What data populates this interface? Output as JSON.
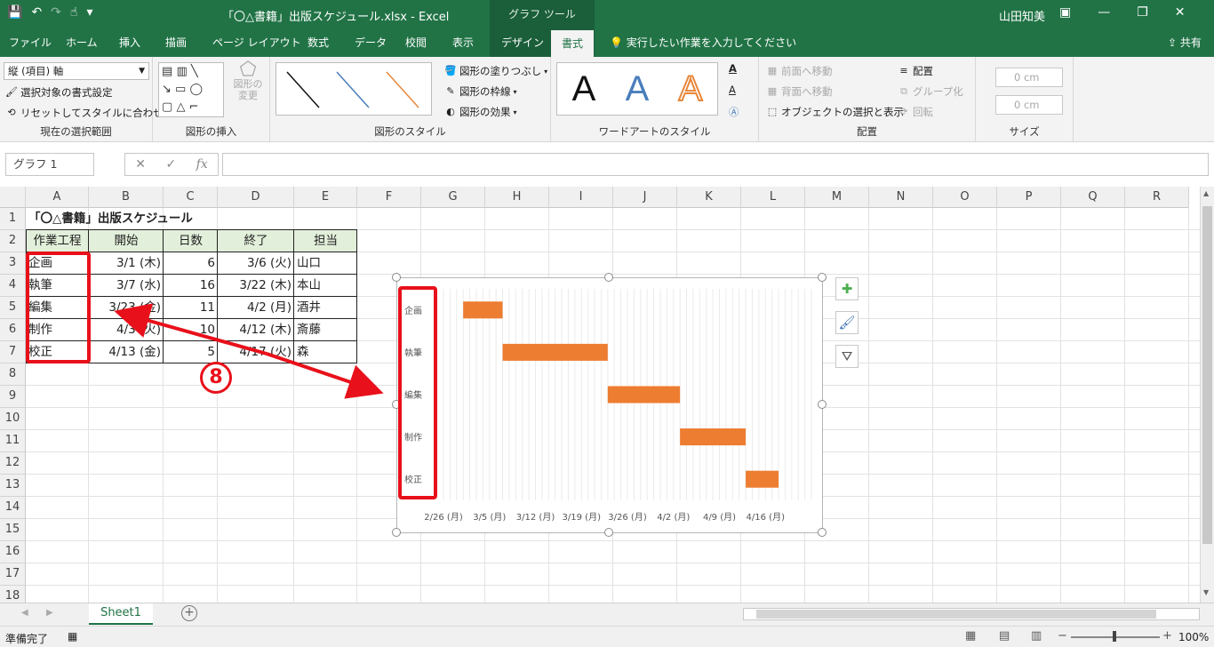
{
  "window": {
    "title": "「〇△書籍」出版スケジュール.xlsx  -  Excel",
    "context_tab": "グラフ ツール",
    "user": "山田知美"
  },
  "tabs": [
    "ファイル",
    "ホーム",
    "挿入",
    "描画",
    "ページ レイアウト",
    "数式",
    "データ",
    "校閲",
    "表示",
    "デザイン",
    "書式"
  ],
  "tell_me": "実行したい作業を入力してください",
  "share": "共有",
  "ribbon": {
    "selection": {
      "combo": "縦 (項目) 軸",
      "format_selection": "選択対象の書式設定",
      "reset_style": "リセットしてスタイルに合わせる",
      "label": "現在の選択範囲"
    },
    "insert_shapes": {
      "change_shape": "図形の変更",
      "label": "図形の挿入"
    },
    "shape_styles": {
      "fill": "図形の塗りつぶし",
      "outline": "図形の枠線",
      "effects": "図形の効果",
      "label": "図形のスタイル"
    },
    "wordart": {
      "letters": [
        "A",
        "A",
        "A"
      ],
      "label": "ワードアートのスタイル"
    },
    "arrange": {
      "bring_forward": "前面へ移動",
      "send_backward": "背面へ移動",
      "selection_pane": "オブジェクトの選択と表示",
      "align": "配置",
      "group": "グループ化",
      "rotate": "回転",
      "label": "配置"
    },
    "size": {
      "height": "0 cm",
      "width": "0 cm",
      "label": "サイズ"
    }
  },
  "formula_bar": {
    "name_box": "グラフ 1",
    "fx": "fx",
    "value": ""
  },
  "columns": [
    "A",
    "B",
    "C",
    "D",
    "E",
    "F",
    "G",
    "H",
    "I",
    "J",
    "K",
    "L",
    "M",
    "N",
    "O",
    "P",
    "Q",
    "R"
  ],
  "rows": [
    "1",
    "2",
    "3",
    "4",
    "5",
    "6",
    "7",
    "8",
    "9",
    "10",
    "11",
    "12",
    "13",
    "14",
    "15",
    "16",
    "17",
    "18"
  ],
  "sheet": {
    "title": "「〇△書籍」出版スケジュール",
    "headers": [
      "作業工程",
      "開始",
      "日数",
      "終了",
      "担当"
    ],
    "rows": [
      [
        "企画",
        "3/1 (木)",
        "6",
        "3/6 (火)",
        "山口"
      ],
      [
        "執筆",
        "3/7 (水)",
        "16",
        "3/22 (木)",
        "本山"
      ],
      [
        "編集",
        "3/23 (金)",
        "11",
        "4/2 (月)",
        "酒井"
      ],
      [
        "制作",
        "4/3 (火)",
        "10",
        "4/12 (木)",
        "斎藤"
      ],
      [
        "校正",
        "4/13 (金)",
        "5",
        "4/17 (火)",
        "森"
      ]
    ]
  },
  "annotation": {
    "step_number": "8",
    "highlight_color": "#e8101a",
    "arrow_color": "#e8101a"
  },
  "chart_data": {
    "type": "bar",
    "orientation": "horizontal-stacked-gantt",
    "categories": [
      "企画",
      "執筆",
      "編集",
      "制作",
      "校正"
    ],
    "start": [
      "2018-03-01",
      "2018-03-07",
      "2018-03-23",
      "2018-04-03",
      "2018-04-13"
    ],
    "duration_days": [
      6,
      16,
      11,
      10,
      5
    ],
    "xticks": [
      "2/26 (月)",
      "3/5 (月)",
      "3/12 (月)",
      "3/19 (月)",
      "3/26 (月)",
      "4/2 (月)",
      "4/9 (月)",
      "4/16 (月)"
    ],
    "xlim": [
      "2018-02-26",
      "2018-04-23"
    ],
    "bar_color": "#ed7d31",
    "grid": true
  },
  "sheet_tabs": [
    "Sheet1"
  ],
  "status": {
    "ready": "準備完了",
    "zoom": "100%"
  }
}
